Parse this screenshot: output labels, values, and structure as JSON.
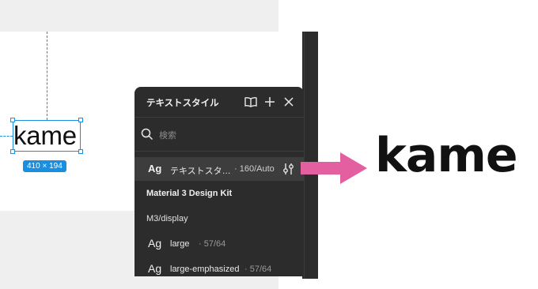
{
  "canvas": {
    "selected_text": "kame",
    "size_badge": "410 × 194",
    "accent_color": "#1a8fe0"
  },
  "panel": {
    "title": "テキストスタイル",
    "icons": [
      "book-icon",
      "plus-icon",
      "close-icon"
    ],
    "search_placeholder": "検索",
    "selected_style": {
      "ag": "Ag",
      "name": "テキストスタ…",
      "meta": "· 160/Auto"
    },
    "library_name": "Material 3 Design Kit",
    "group_name": "M3/display",
    "styles": [
      {
        "ag": "Ag",
        "name": "large",
        "meta": "· 57/64"
      },
      {
        "ag": "Ag",
        "name": "large-emphasized",
        "meta": "· 57/64"
      }
    ]
  },
  "result": {
    "logo_text": "kame",
    "arrow_color": "#e35fa0"
  }
}
